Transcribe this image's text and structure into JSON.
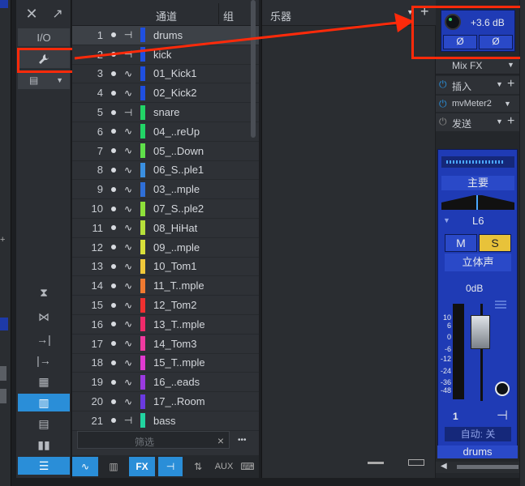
{
  "header": {
    "close_icon": "close-icon",
    "expand_icon": "expand-icon",
    "channels_label": "通道",
    "group_label": "组",
    "instruments_label": "乐器"
  },
  "tools": {
    "io_label": "I/O"
  },
  "channels": [
    {
      "num": "1",
      "type": "audio",
      "color": "#1f4fe0",
      "name": "drums"
    },
    {
      "num": "2",
      "type": "audio",
      "color": "#1f4fe0",
      "name": "kick"
    },
    {
      "num": "3",
      "type": "inst",
      "color": "#1f4fe0",
      "name": "01_Kick1"
    },
    {
      "num": "4",
      "type": "inst",
      "color": "#1f4fe0",
      "name": "02_Kick2"
    },
    {
      "num": "5",
      "type": "audio",
      "color": "#22d466",
      "name": "snare"
    },
    {
      "num": "6",
      "type": "inst",
      "color": "#22d466",
      "name": "04_..reUp"
    },
    {
      "num": "7",
      "type": "inst",
      "color": "#5fe04a",
      "name": "05_..Down"
    },
    {
      "num": "8",
      "type": "inst",
      "color": "#3a8fe0",
      "name": "06_S..ple1"
    },
    {
      "num": "9",
      "type": "inst",
      "color": "#2f6fd8",
      "name": "03_..mple"
    },
    {
      "num": "10",
      "type": "inst",
      "color": "#8ee03a",
      "name": "07_S..ple2"
    },
    {
      "num": "11",
      "type": "inst",
      "color": "#b6e03a",
      "name": "08_HiHat"
    },
    {
      "num": "12",
      "type": "inst",
      "color": "#d8e03a",
      "name": "09_..mple"
    },
    {
      "num": "13",
      "type": "inst",
      "color": "#f0c83a",
      "name": "10_Tom1"
    },
    {
      "num": "14",
      "type": "inst",
      "color": "#f07a30",
      "name": "11_T..mple"
    },
    {
      "num": "15",
      "type": "inst",
      "color": "#f03030",
      "name": "12_Tom2"
    },
    {
      "num": "16",
      "type": "inst",
      "color": "#f02a6a",
      "name": "13_T..mple"
    },
    {
      "num": "17",
      "type": "inst",
      "color": "#f03aa0",
      "name": "14_Tom3"
    },
    {
      "num": "18",
      "type": "inst",
      "color": "#e03ad0",
      "name": "15_T..mple"
    },
    {
      "num": "19",
      "type": "inst",
      "color": "#9a3ae0",
      "name": "16_..eads"
    },
    {
      "num": "20",
      "type": "inst",
      "color": "#6a3ae0",
      "name": "17_..Room"
    },
    {
      "num": "21",
      "type": "audio",
      "color": "#22d4a0",
      "name": "bass"
    }
  ],
  "filter": {
    "placeholder": "筛选",
    "clear": "×",
    "more": "•••"
  },
  "bottom_tabs": [
    "FX",
    "AUX"
  ],
  "mixer": {
    "gain": "+3.6 dB",
    "phase1": "Ø",
    "phase2": "Ø",
    "mixfx": "Mix FX",
    "insert": "插入",
    "plugin": "mvMeter2",
    "send": "发送",
    "main": "主要",
    "pan": "L6",
    "mute": "M",
    "solo": "S",
    "stereo": "立体声",
    "volume": "0dB",
    "scale": [
      "10",
      "6",
      "0",
      "-6",
      "-12",
      "-24",
      "-36",
      "-48"
    ],
    "channel_num": "1",
    "auto": "自动: 关",
    "channel_name": "drums"
  },
  "colors": {
    "accent_blue": "#1f3bb5",
    "highlight_red": "#ff2a0a",
    "solo_yellow": "#e8c23a"
  }
}
